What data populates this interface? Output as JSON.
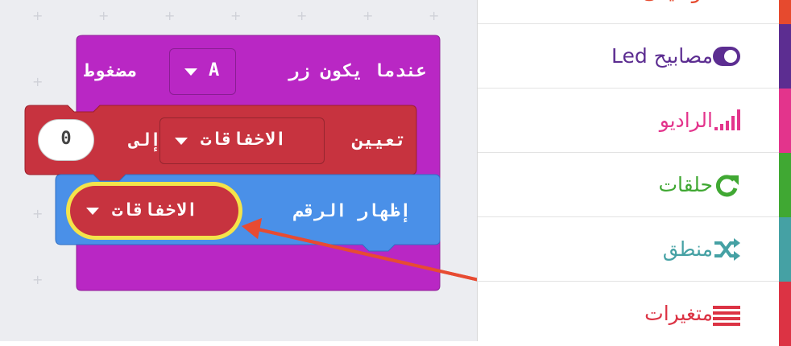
{
  "workspace": {
    "event_block": {
      "text": "عندما يكون زر",
      "button": "A",
      "pressed": "مضغوط",
      "color": "#b927c4"
    },
    "set_block": {
      "set_label": "تعيين",
      "variable": "الاخفاقات",
      "to_label": "إلى",
      "value": "0",
      "color": "#c7333f"
    },
    "show_block": {
      "label": "إظهار الرقم",
      "variable": "الاخفاقات",
      "color": "#4a90e8",
      "highlight": "#f4e34a"
    },
    "arrow_color": "#e74b32"
  },
  "toolbox": {
    "categories": [
      {
        "label": "موسيقى",
        "icon": "music-icon",
        "color": "#e64a2e"
      },
      {
        "label": "مصابيح Led",
        "icon": "toggle-icon",
        "color": "#5c2d91"
      },
      {
        "label": "الراديو",
        "icon": "signal-bars-icon",
        "color": "#e3348c"
      },
      {
        "label": "حلقات",
        "icon": "loop-icon",
        "color": "#40a833"
      },
      {
        "label": "منطق",
        "icon": "shuffle-icon",
        "color": "#45a1a4"
      },
      {
        "label": "متغيرات",
        "icon": "variables-icon",
        "color": "#dc3344"
      }
    ]
  }
}
